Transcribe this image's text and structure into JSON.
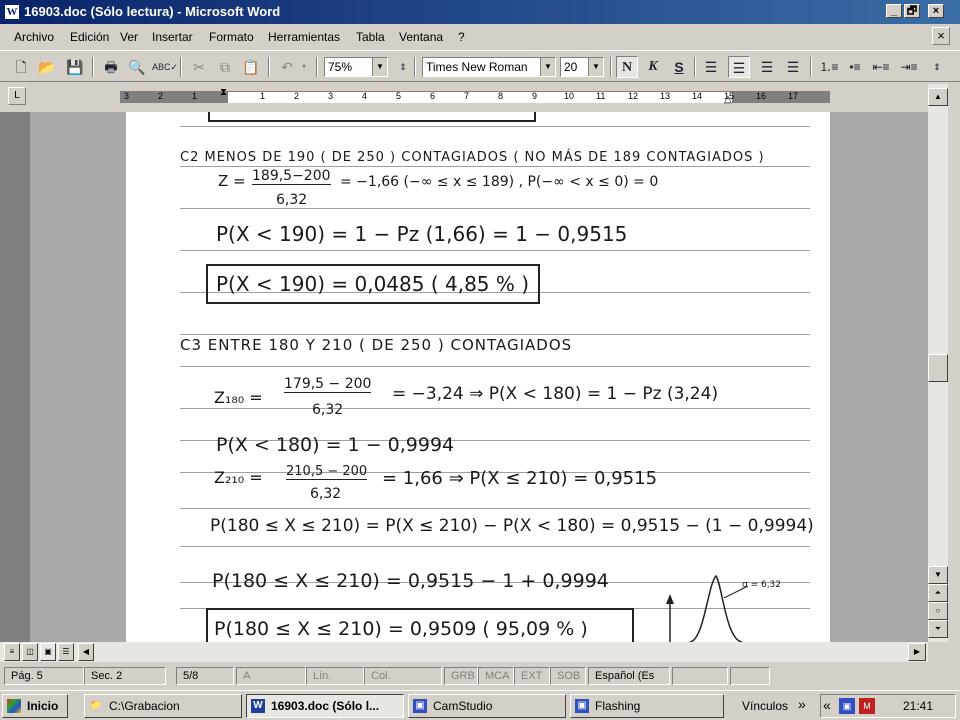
{
  "window": {
    "title": "16903.doc (Sólo lectura) - Microsoft Word",
    "app_icon": "W",
    "min_glyph": "_",
    "max_glyph": "🗗",
    "close_glyph": "×"
  },
  "menu": {
    "items": [
      "Archivo",
      "Edición",
      "Ver",
      "Insertar",
      "Formato",
      "Herramientas",
      "Tabla",
      "Ventana",
      "?"
    ],
    "close_glyph": "×"
  },
  "toolbar": {
    "zoom": "75%",
    "font": "Times New Roman",
    "size": "20",
    "bold": "N",
    "italic": "K",
    "underline": "S"
  },
  "ruler": {
    "tick_labels": [
      "3",
      "2",
      "1",
      "1",
      "2",
      "3",
      "4",
      "5",
      "6",
      "7",
      "8",
      "9",
      "10",
      "11",
      "12",
      "13",
      "14",
      "15",
      "16",
      "17"
    ],
    "tab_glyph": "L"
  },
  "document": {
    "lines": [
      "C2   MENOS DE  190  ( DE 250 )  CONTAGIADOS  ( NO MÁS DE 189 CONTAGIADOS )",
      "Z = (189,5−200) / 6,32 = −1,66   (−∞ ≤ x ≤ 189) ,  P(−∞ < x ≤ 0) = 0",
      "P(X < 190) = 1 − Pz (1,66) = 1 − 0,9515",
      "P(X < 190) = 0,0485    ( 4,85 % )",
      "C3   ENTRE  180  Y  210  ( DE 250 )  CONTAGIADOS",
      "Z180 = (179,5 − 200) / 6,32 = −3,24  ⇒  P(X < 180) = 1 − Pz (3,24)",
      "P(X < 180) = 1 − 0,9994",
      "Z210 = (210,5 − 200) / 6,32 = 1,66 ⇒  P(X ≤ 210) = 0,9515",
      "P(180 ≤ X ≤ 210) = P(X ≤ 210) − P(X < 180) = 0,9515 − (1 − 0,9994)",
      "P(180 ≤ X ≤ 210) = 0,9515 − 1 + 0,9994",
      "P(180 ≤ X ≤ 210) = 0,9509     ( 95,09 % )"
    ],
    "z1_num": "189,5−200",
    "z1_den": "6,32",
    "z2_num": "179,5 − 200",
    "z2_den": "6,32",
    "z3_num": "210,5 − 200",
    "z3_den": "6,32",
    "sigma_label": "σ = 6,32"
  },
  "statusbar": {
    "page": "Pág. 5",
    "sec": "Sec. 2",
    "pages": "5/8",
    "at": "A",
    "ln": "Lín.",
    "col": "Col.",
    "grb": "GRB",
    "mca": "MCA",
    "ext": "EXT",
    "sob": "SOB",
    "lang": "Español (Es"
  },
  "taskbar": {
    "start": "Inicio",
    "tasks": [
      "C:\\Grabacion",
      "16903.doc (Sólo l...",
      "CamStudio",
      "Flashing"
    ],
    "vinculos": "Vínculos",
    "clock": "21:41",
    "chev": "»",
    "chev2": "«"
  },
  "colors": {
    "title_start": "#0a246a",
    "title_end": "#3a6ea5",
    "face": "#d4d0c8"
  }
}
